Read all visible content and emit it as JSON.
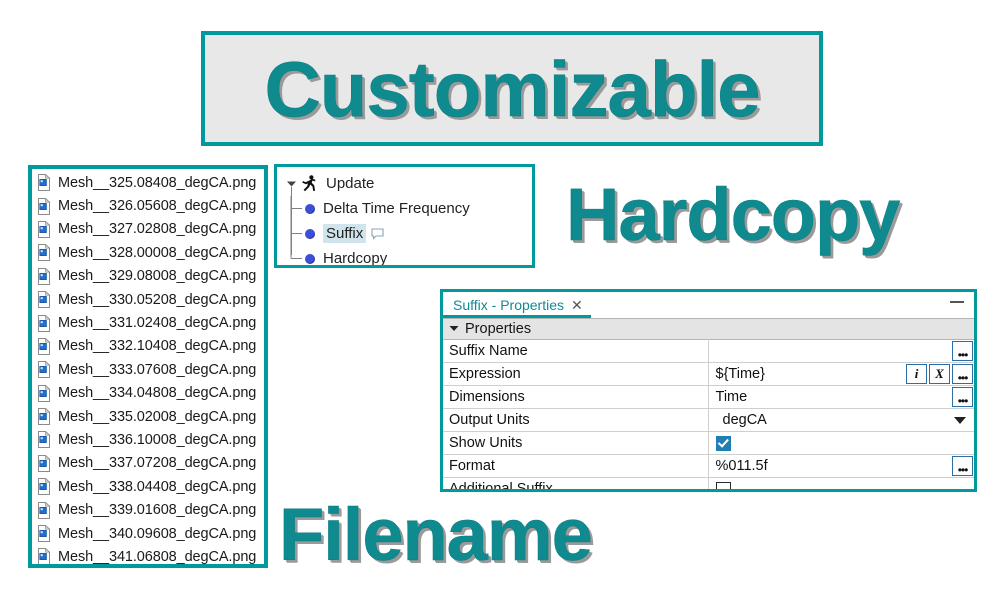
{
  "banner": {
    "customizable": "Customizable",
    "hardcopy": "Hardcopy",
    "filename": "Filename"
  },
  "colors": {
    "teal": "#00999d",
    "teal_text": "#0f8b90",
    "banner_bg": "#e8e8e8",
    "selection": "#cfe4ec",
    "node_bullet": "#3b4fd8",
    "checkbox_on": "#1f7fb5",
    "button_border": "#2d6ea8"
  },
  "filelist": {
    "icon": "image-file-icon",
    "files": [
      "Mesh__325.08408_degCA.png",
      "Mesh__326.05608_degCA.png",
      "Mesh__327.02808_degCA.png",
      "Mesh__328.00008_degCA.png",
      "Mesh__329.08008_degCA.png",
      "Mesh__330.05208_degCA.png",
      "Mesh__331.02408_degCA.png",
      "Mesh__332.10408_degCA.png",
      "Mesh__333.07608_degCA.png",
      "Mesh__334.04808_degCA.png",
      "Mesh__335.02008_degCA.png",
      "Mesh__336.10008_degCA.png",
      "Mesh__337.07208_degCA.png",
      "Mesh__338.04408_degCA.png",
      "Mesh__339.01608_degCA.png",
      "Mesh__340.09608_degCA.png",
      "Mesh__341.06808_degCA.png"
    ]
  },
  "tree": {
    "root": {
      "label": "Update",
      "icon": "runner-icon",
      "expanded": true
    },
    "children": [
      {
        "label": "Delta Time Frequency",
        "icon": "blue-bullet-icon",
        "selected": false,
        "has_comment": false
      },
      {
        "label": "Suffix",
        "icon": "blue-bullet-icon",
        "selected": true,
        "has_comment": true
      },
      {
        "label": "Hardcopy",
        "icon": "blue-bullet-icon",
        "selected": false,
        "has_comment": false
      }
    ]
  },
  "properties_panel": {
    "tab_title": "Suffix - Properties",
    "close_glyph": "✕",
    "group_header": "Properties",
    "rows": [
      {
        "label": "Suffix Name",
        "value": "",
        "control": "ellipsis"
      },
      {
        "label": "Expression",
        "value": "${Time}",
        "control": "expression"
      },
      {
        "label": "Dimensions",
        "value": "Time",
        "control": "ellipsis"
      },
      {
        "label": "Output Units",
        "value": "degCA",
        "control": "dropdown"
      },
      {
        "label": "Show Units",
        "value": "",
        "control": "checkbox-checked"
      },
      {
        "label": "Format",
        "value": "%011.5f",
        "control": "ellipsis"
      },
      {
        "label": "Additional Suffix",
        "value": "",
        "control": "checkbox-unchecked"
      }
    ],
    "buttons": {
      "info": "i",
      "clear": "X",
      "ellipsis": "•••"
    }
  }
}
